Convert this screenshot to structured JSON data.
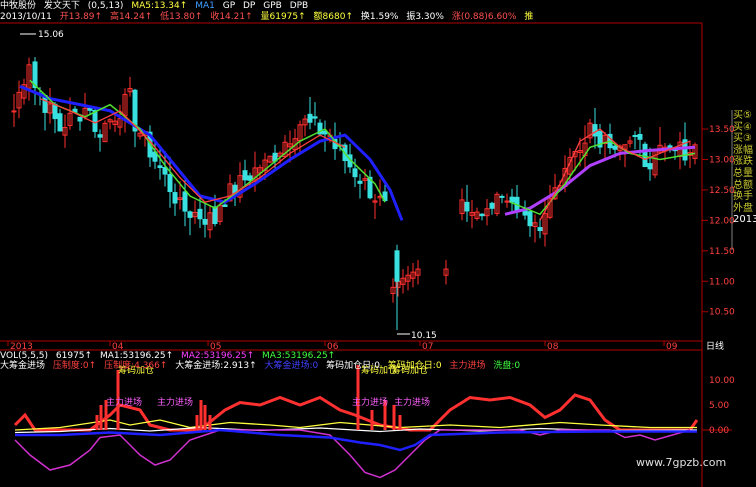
{
  "top_bar": {
    "stock_name": "中牧股份",
    "indicator": "发文天下",
    "indicator_params": "(0,5,13)",
    "ma5": "MA5:13.34↑",
    "ma_extra": "MA1",
    "extra_items": [
      "GP",
      "DP",
      "GPB",
      "DPB"
    ]
  },
  "info_bar": {
    "date": "2013/10/11",
    "open": "开13.89↑",
    "high": "高14.24↑",
    "low": "低13.80↑",
    "close": "收14.21↑",
    "volume": "量61975↑",
    "amount": "额8680↑",
    "turnover": "换1.59%",
    "amplitude": "振3.30%",
    "change": "涨(0.88)6.60%",
    "trailing": "推"
  },
  "price_axis": {
    "labels": [
      "13.50",
      "13.00",
      "12.50",
      "12.00",
      "11.50",
      "11.00",
      "10.50"
    ]
  },
  "annotations": {
    "high_label": "15.06",
    "low_label": "10.15"
  },
  "time_axis": {
    "labels": [
      "2013",
      "04",
      "05",
      "06",
      "07",
      "08",
      "09"
    ],
    "period": "日线"
  },
  "right_panel": {
    "items": [
      "买⑤",
      "买④",
      "买③",
      "涨幅",
      "涨跌",
      "总量",
      "总额",
      "换手",
      "外盘",
      "2013"
    ]
  },
  "vol_bar": {
    "label": "VOL(5,5,5)",
    "value": "61975↑",
    "ma1": "MA1:53196.25↑",
    "ma2": "MA2:53196.25↑",
    "ma3": "MA3:53196.25↑"
  },
  "signal_bar": {
    "big_money": "大筹金进场",
    "pressure": "压制度:0↑",
    "pressure_val": "压制度:4.366↑",
    "entry": "大筹金进场:2.913↑",
    "entry2": "大筹金进场:0",
    "chip_add": "筹码加仓日:0",
    "chip_add2": "筹码加仓日:0",
    "main_entry": "主力进场",
    "wash": "洗盘:0"
  },
  "indicator_axis": {
    "labels": [
      "10.00",
      "5.00",
      "0.00"
    ]
  },
  "chart_tags": {
    "chip_add_tag": "筹码加仓",
    "main_entry_tag": "主力进场"
  },
  "watermark": "www.7gpzb.com",
  "chart_data": {
    "type": "candlestick",
    "title": "",
    "ylim": [
      10.0,
      15.2
    ],
    "y_ticks": [
      13.5,
      13.0,
      12.5,
      12.0,
      11.5,
      11.0,
      10.5
    ],
    "x_labels": [
      "2013",
      "04",
      "05",
      "06",
      "07",
      "08",
      "09"
    ],
    "high_marker": 15.06,
    "low_marker": 10.15,
    "indicator_ylim": [
      -5,
      15
    ],
    "indicator_ticks": [
      10.0,
      5.0,
      0.0
    ],
    "colors": {
      "up": "#ff3030",
      "down": "#38e0e0",
      "ma_blue": "#2020ff",
      "ma_green": "#50e030",
      "ma_purple": "#b040ff",
      "ma_red": "#ff4040",
      "yellow": "#ffff40",
      "white": "#ffffff",
      "magenta": "#d030d0"
    }
  }
}
